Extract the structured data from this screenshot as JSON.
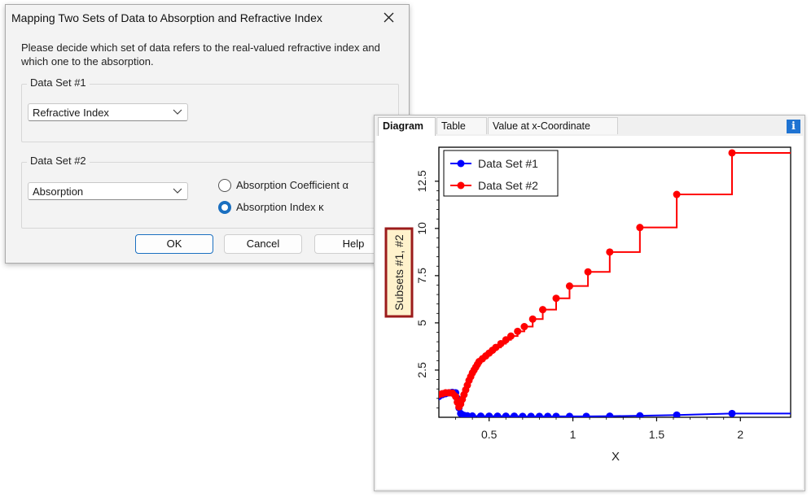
{
  "dialog": {
    "title": "Mapping Two Sets of Data to Absorption and Refractive Index",
    "message": "Please decide which set of data refers to the real-valued refractive index and which one to the absorption.",
    "group1": {
      "legend": "Data Set #1",
      "selected": "Refractive Index"
    },
    "group2": {
      "legend": "Data Set #2",
      "selected": "Absorption"
    },
    "radio_absorption_coefficient": {
      "label": "Absorption Coefficient α",
      "checked": false
    },
    "radio_absorption_index": {
      "label": "Absorption Index κ",
      "checked": true
    },
    "ok_label": "OK",
    "cancel_label": "Cancel",
    "help_label": "Help"
  },
  "panel": {
    "tabs": [
      "Diagram",
      "Table",
      "Value at x-Coordinate"
    ],
    "active_tab": "Diagram",
    "info_label": "i"
  },
  "colors": {
    "accent": "#1a6fc0",
    "series1": "#0000ff",
    "series2": "#ff0000",
    "ylabel_box": "#9b1b1b",
    "ylabel_fill": "#fff2cc"
  },
  "chart_data": {
    "type": "line",
    "xlabel": "X",
    "ylabel": "Subsets #1, #2",
    "xlim": [
      0.2,
      2.3
    ],
    "ylim": [
      0,
      14.3
    ],
    "x_ticks": [
      0.5,
      1,
      1.5,
      2
    ],
    "x_tick_labels": [
      "0.5",
      "1",
      "1.5",
      "2"
    ],
    "y_ticks": [
      2.5,
      5,
      7.5,
      10,
      12.5
    ],
    "y_tick_labels": [
      "2.5",
      "5",
      "7.5",
      "10",
      "12.5"
    ],
    "grid": false,
    "legend_position": "top-left",
    "series": [
      {
        "name": "Data Set #1",
        "color": "#0000ff",
        "step": false,
        "points": [
          [
            0.2,
            1.1
          ],
          [
            0.22,
            1.2
          ],
          [
            0.24,
            1.25
          ],
          [
            0.26,
            1.3
          ],
          [
            0.28,
            1.32
          ],
          [
            0.3,
            1.3
          ],
          [
            0.31,
            1.0
          ],
          [
            0.32,
            0.5
          ],
          [
            0.33,
            0.2
          ],
          [
            0.35,
            0.1
          ],
          [
            0.37,
            0.08
          ],
          [
            0.4,
            0.07
          ],
          [
            0.45,
            0.06
          ],
          [
            0.5,
            0.06
          ],
          [
            0.55,
            0.06
          ],
          [
            0.6,
            0.06
          ],
          [
            0.65,
            0.06
          ],
          [
            0.7,
            0.05
          ],
          [
            0.75,
            0.05
          ],
          [
            0.8,
            0.05
          ],
          [
            0.85,
            0.05
          ],
          [
            0.9,
            0.05
          ],
          [
            0.98,
            0.05
          ],
          [
            1.08,
            0.05
          ],
          [
            1.22,
            0.06
          ],
          [
            1.4,
            0.08
          ],
          [
            1.62,
            0.12
          ],
          [
            1.95,
            0.2
          ],
          [
            2.3,
            0.2
          ]
        ]
      },
      {
        "name": "Data Set #2",
        "color": "#ff0000",
        "step": true,
        "points": [
          [
            0.2,
            1.2
          ],
          [
            0.22,
            1.25
          ],
          [
            0.24,
            1.3
          ],
          [
            0.26,
            1.3
          ],
          [
            0.28,
            1.28
          ],
          [
            0.3,
            1.1
          ],
          [
            0.31,
            0.8
          ],
          [
            0.32,
            0.55
          ],
          [
            0.33,
            0.7
          ],
          [
            0.34,
            0.95
          ],
          [
            0.35,
            1.2
          ],
          [
            0.36,
            1.45
          ],
          [
            0.37,
            1.7
          ],
          [
            0.38,
            1.95
          ],
          [
            0.39,
            2.15
          ],
          [
            0.4,
            2.35
          ],
          [
            0.41,
            2.5
          ],
          [
            0.42,
            2.65
          ],
          [
            0.43,
            2.8
          ],
          [
            0.44,
            2.95
          ],
          [
            0.46,
            3.1
          ],
          [
            0.48,
            3.25
          ],
          [
            0.5,
            3.4
          ],
          [
            0.52,
            3.55
          ],
          [
            0.54,
            3.7
          ],
          [
            0.57,
            3.9
          ],
          [
            0.6,
            4.1
          ],
          [
            0.63,
            4.3
          ],
          [
            0.67,
            4.55
          ],
          [
            0.71,
            4.8
          ],
          [
            0.76,
            5.2
          ],
          [
            0.82,
            5.7
          ],
          [
            0.9,
            6.3
          ],
          [
            0.98,
            6.95
          ],
          [
            1.09,
            7.7
          ],
          [
            1.22,
            8.75
          ],
          [
            1.4,
            10.05
          ],
          [
            1.62,
            11.8
          ],
          [
            1.95,
            14.0
          ],
          [
            2.3,
            14.0
          ]
        ]
      }
    ]
  }
}
